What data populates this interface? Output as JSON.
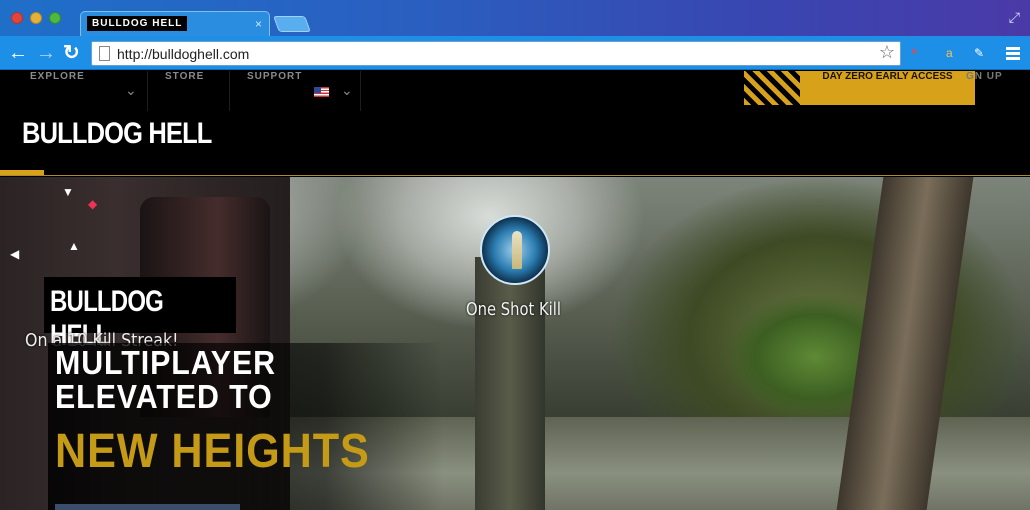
{
  "browser": {
    "tab_title_logo": "BULLDOG HELL",
    "tab_close": "×",
    "url": "http://bulldoghell.com",
    "back": "←",
    "forward": "→",
    "reload": "↻",
    "star": "☆",
    "extensions": [
      "ebay-icon",
      "amazon-icon",
      "tool-icon"
    ]
  },
  "site": {
    "nav": [
      {
        "label": "EXPLORE",
        "has_dropdown": true
      },
      {
        "label": "STORE",
        "has_dropdown": false
      },
      {
        "label": "SUPPORT",
        "has_dropdown": false
      }
    ],
    "region": {
      "icon": "us-flag-icon",
      "has_dropdown": true
    },
    "promo_label": "DAY ZERO EARLY ACCESS",
    "signup_label": "GN UP",
    "logo_text": "BULLDOG HELL",
    "accent_color": "#d7a21a"
  },
  "hero": {
    "medal_label": "One Shot Kill",
    "badge_logo": "BULLDOG HELL",
    "kill_streak": "On a 10 Kill Streak!",
    "headline_line1": "MULTIPLAYER",
    "headline_line2": "ELEVATED TO",
    "headline_line3": "NEW HEIGHTS"
  }
}
